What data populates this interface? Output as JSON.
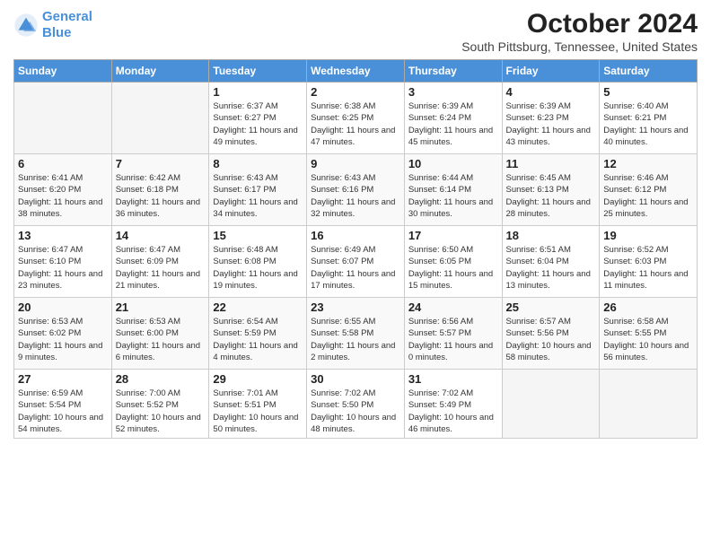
{
  "logo": {
    "line1": "General",
    "line2": "Blue"
  },
  "title": "October 2024",
  "subtitle": "South Pittsburg, Tennessee, United States",
  "days_of_week": [
    "Sunday",
    "Monday",
    "Tuesday",
    "Wednesday",
    "Thursday",
    "Friday",
    "Saturday"
  ],
  "weeks": [
    [
      {
        "day": "",
        "info": ""
      },
      {
        "day": "",
        "info": ""
      },
      {
        "day": "1",
        "info": "Sunrise: 6:37 AM\nSunset: 6:27 PM\nDaylight: 11 hours and 49 minutes."
      },
      {
        "day": "2",
        "info": "Sunrise: 6:38 AM\nSunset: 6:25 PM\nDaylight: 11 hours and 47 minutes."
      },
      {
        "day": "3",
        "info": "Sunrise: 6:39 AM\nSunset: 6:24 PM\nDaylight: 11 hours and 45 minutes."
      },
      {
        "day": "4",
        "info": "Sunrise: 6:39 AM\nSunset: 6:23 PM\nDaylight: 11 hours and 43 minutes."
      },
      {
        "day": "5",
        "info": "Sunrise: 6:40 AM\nSunset: 6:21 PM\nDaylight: 11 hours and 40 minutes."
      }
    ],
    [
      {
        "day": "6",
        "info": "Sunrise: 6:41 AM\nSunset: 6:20 PM\nDaylight: 11 hours and 38 minutes."
      },
      {
        "day": "7",
        "info": "Sunrise: 6:42 AM\nSunset: 6:18 PM\nDaylight: 11 hours and 36 minutes."
      },
      {
        "day": "8",
        "info": "Sunrise: 6:43 AM\nSunset: 6:17 PM\nDaylight: 11 hours and 34 minutes."
      },
      {
        "day": "9",
        "info": "Sunrise: 6:43 AM\nSunset: 6:16 PM\nDaylight: 11 hours and 32 minutes."
      },
      {
        "day": "10",
        "info": "Sunrise: 6:44 AM\nSunset: 6:14 PM\nDaylight: 11 hours and 30 minutes."
      },
      {
        "day": "11",
        "info": "Sunrise: 6:45 AM\nSunset: 6:13 PM\nDaylight: 11 hours and 28 minutes."
      },
      {
        "day": "12",
        "info": "Sunrise: 6:46 AM\nSunset: 6:12 PM\nDaylight: 11 hours and 25 minutes."
      }
    ],
    [
      {
        "day": "13",
        "info": "Sunrise: 6:47 AM\nSunset: 6:10 PM\nDaylight: 11 hours and 23 minutes."
      },
      {
        "day": "14",
        "info": "Sunrise: 6:47 AM\nSunset: 6:09 PM\nDaylight: 11 hours and 21 minutes."
      },
      {
        "day": "15",
        "info": "Sunrise: 6:48 AM\nSunset: 6:08 PM\nDaylight: 11 hours and 19 minutes."
      },
      {
        "day": "16",
        "info": "Sunrise: 6:49 AM\nSunset: 6:07 PM\nDaylight: 11 hours and 17 minutes."
      },
      {
        "day": "17",
        "info": "Sunrise: 6:50 AM\nSunset: 6:05 PM\nDaylight: 11 hours and 15 minutes."
      },
      {
        "day": "18",
        "info": "Sunrise: 6:51 AM\nSunset: 6:04 PM\nDaylight: 11 hours and 13 minutes."
      },
      {
        "day": "19",
        "info": "Sunrise: 6:52 AM\nSunset: 6:03 PM\nDaylight: 11 hours and 11 minutes."
      }
    ],
    [
      {
        "day": "20",
        "info": "Sunrise: 6:53 AM\nSunset: 6:02 PM\nDaylight: 11 hours and 9 minutes."
      },
      {
        "day": "21",
        "info": "Sunrise: 6:53 AM\nSunset: 6:00 PM\nDaylight: 11 hours and 6 minutes."
      },
      {
        "day": "22",
        "info": "Sunrise: 6:54 AM\nSunset: 5:59 PM\nDaylight: 11 hours and 4 minutes."
      },
      {
        "day": "23",
        "info": "Sunrise: 6:55 AM\nSunset: 5:58 PM\nDaylight: 11 hours and 2 minutes."
      },
      {
        "day": "24",
        "info": "Sunrise: 6:56 AM\nSunset: 5:57 PM\nDaylight: 11 hours and 0 minutes."
      },
      {
        "day": "25",
        "info": "Sunrise: 6:57 AM\nSunset: 5:56 PM\nDaylight: 10 hours and 58 minutes."
      },
      {
        "day": "26",
        "info": "Sunrise: 6:58 AM\nSunset: 5:55 PM\nDaylight: 10 hours and 56 minutes."
      }
    ],
    [
      {
        "day": "27",
        "info": "Sunrise: 6:59 AM\nSunset: 5:54 PM\nDaylight: 10 hours and 54 minutes."
      },
      {
        "day": "28",
        "info": "Sunrise: 7:00 AM\nSunset: 5:52 PM\nDaylight: 10 hours and 52 minutes."
      },
      {
        "day": "29",
        "info": "Sunrise: 7:01 AM\nSunset: 5:51 PM\nDaylight: 10 hours and 50 minutes."
      },
      {
        "day": "30",
        "info": "Sunrise: 7:02 AM\nSunset: 5:50 PM\nDaylight: 10 hours and 48 minutes."
      },
      {
        "day": "31",
        "info": "Sunrise: 7:02 AM\nSunset: 5:49 PM\nDaylight: 10 hours and 46 minutes."
      },
      {
        "day": "",
        "info": ""
      },
      {
        "day": "",
        "info": ""
      }
    ]
  ]
}
